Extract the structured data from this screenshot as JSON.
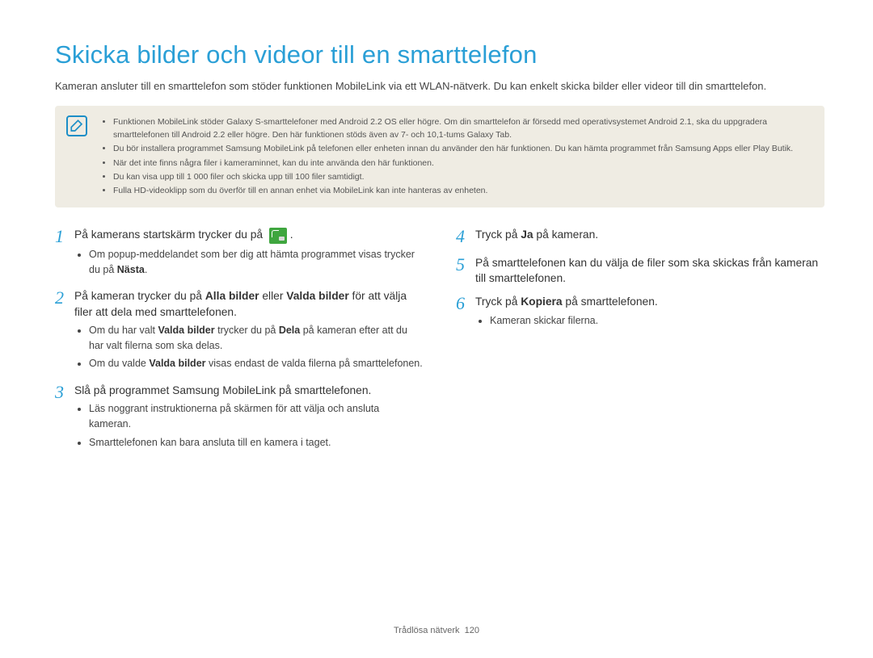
{
  "title": "Skicka bilder och videor till en smarttelefon",
  "intro": "Kameran ansluter till en smarttelefon som stöder funktionen MobileLink via ett WLAN-nätverk. Du kan enkelt skicka bilder eller videor till din smarttelefon.",
  "notes": [
    "Funktionen MobileLink stöder Galaxy S-smarttelefoner med Android 2.2 OS eller högre. Om din smarttelefon är försedd med operativsystemet Android 2.1, ska du uppgradera smarttelefonen till Android 2.2 eller högre. Den här funktionen stöds även av 7- och 10,1-tums Galaxy Tab.",
    "Du bör installera programmet Samsung MobileLink på telefonen eller enheten innan du använder den här funktionen. Du kan hämta programmet från Samsung Apps eller Play Butik.",
    "När det inte finns några filer i kameraminnet, kan du inte använda den här funktionen.",
    "Du kan visa upp till 1 000 filer och skicka upp till 100 filer samtidigt.",
    "Fulla HD-videoklipp som du överför till en annan enhet via MobileLink kan inte hanteras av enheten."
  ],
  "steps": {
    "s1": {
      "num": "1",
      "text_a": "På kamerans startskärm trycker du på ",
      "text_b": ".",
      "bullets": [
        {
          "pre": "Om popup-meddelandet som ber dig att hämta programmet visas trycker du på ",
          "bold": "Nästa",
          "post": "."
        }
      ]
    },
    "s2": {
      "num": "2",
      "text_a": "På kameran trycker du på ",
      "bold1": "Alla bilder",
      "mid": " eller ",
      "bold2": "Valda bilder",
      "text_b": " för att välja filer att dela med smarttelefonen.",
      "bullets": [
        {
          "pre": "Om du har valt ",
          "bold": "Valda bilder",
          "mid": " trycker du på ",
          "bold2": "Dela",
          "post": " på kameran efter att du har valt filerna som ska delas."
        },
        {
          "pre": "Om du valde ",
          "bold": "Valda bilder",
          "post": " visas endast de valda filerna på smarttelefonen."
        }
      ]
    },
    "s3": {
      "num": "3",
      "text": "Slå på programmet Samsung MobileLink på smarttelefonen.",
      "bullets": [
        "Läs noggrant instruktionerna på skärmen för att välja och ansluta kameran.",
        "Smarttelefonen kan bara ansluta till en kamera i taget."
      ]
    },
    "s4": {
      "num": "4",
      "text_a": "Tryck på ",
      "bold": "Ja",
      "text_b": " på kameran."
    },
    "s5": {
      "num": "5",
      "text": "På smarttelefonen kan du välja de filer som ska skickas från kameran till smarttelefonen."
    },
    "s6": {
      "num": "6",
      "text_a": "Tryck på ",
      "bold": "Kopiera",
      "text_b": " på smarttelefonen.",
      "bullets": [
        "Kameran skickar filerna."
      ]
    }
  },
  "footer": {
    "section": "Trådlösa nätverk",
    "page": "120"
  }
}
